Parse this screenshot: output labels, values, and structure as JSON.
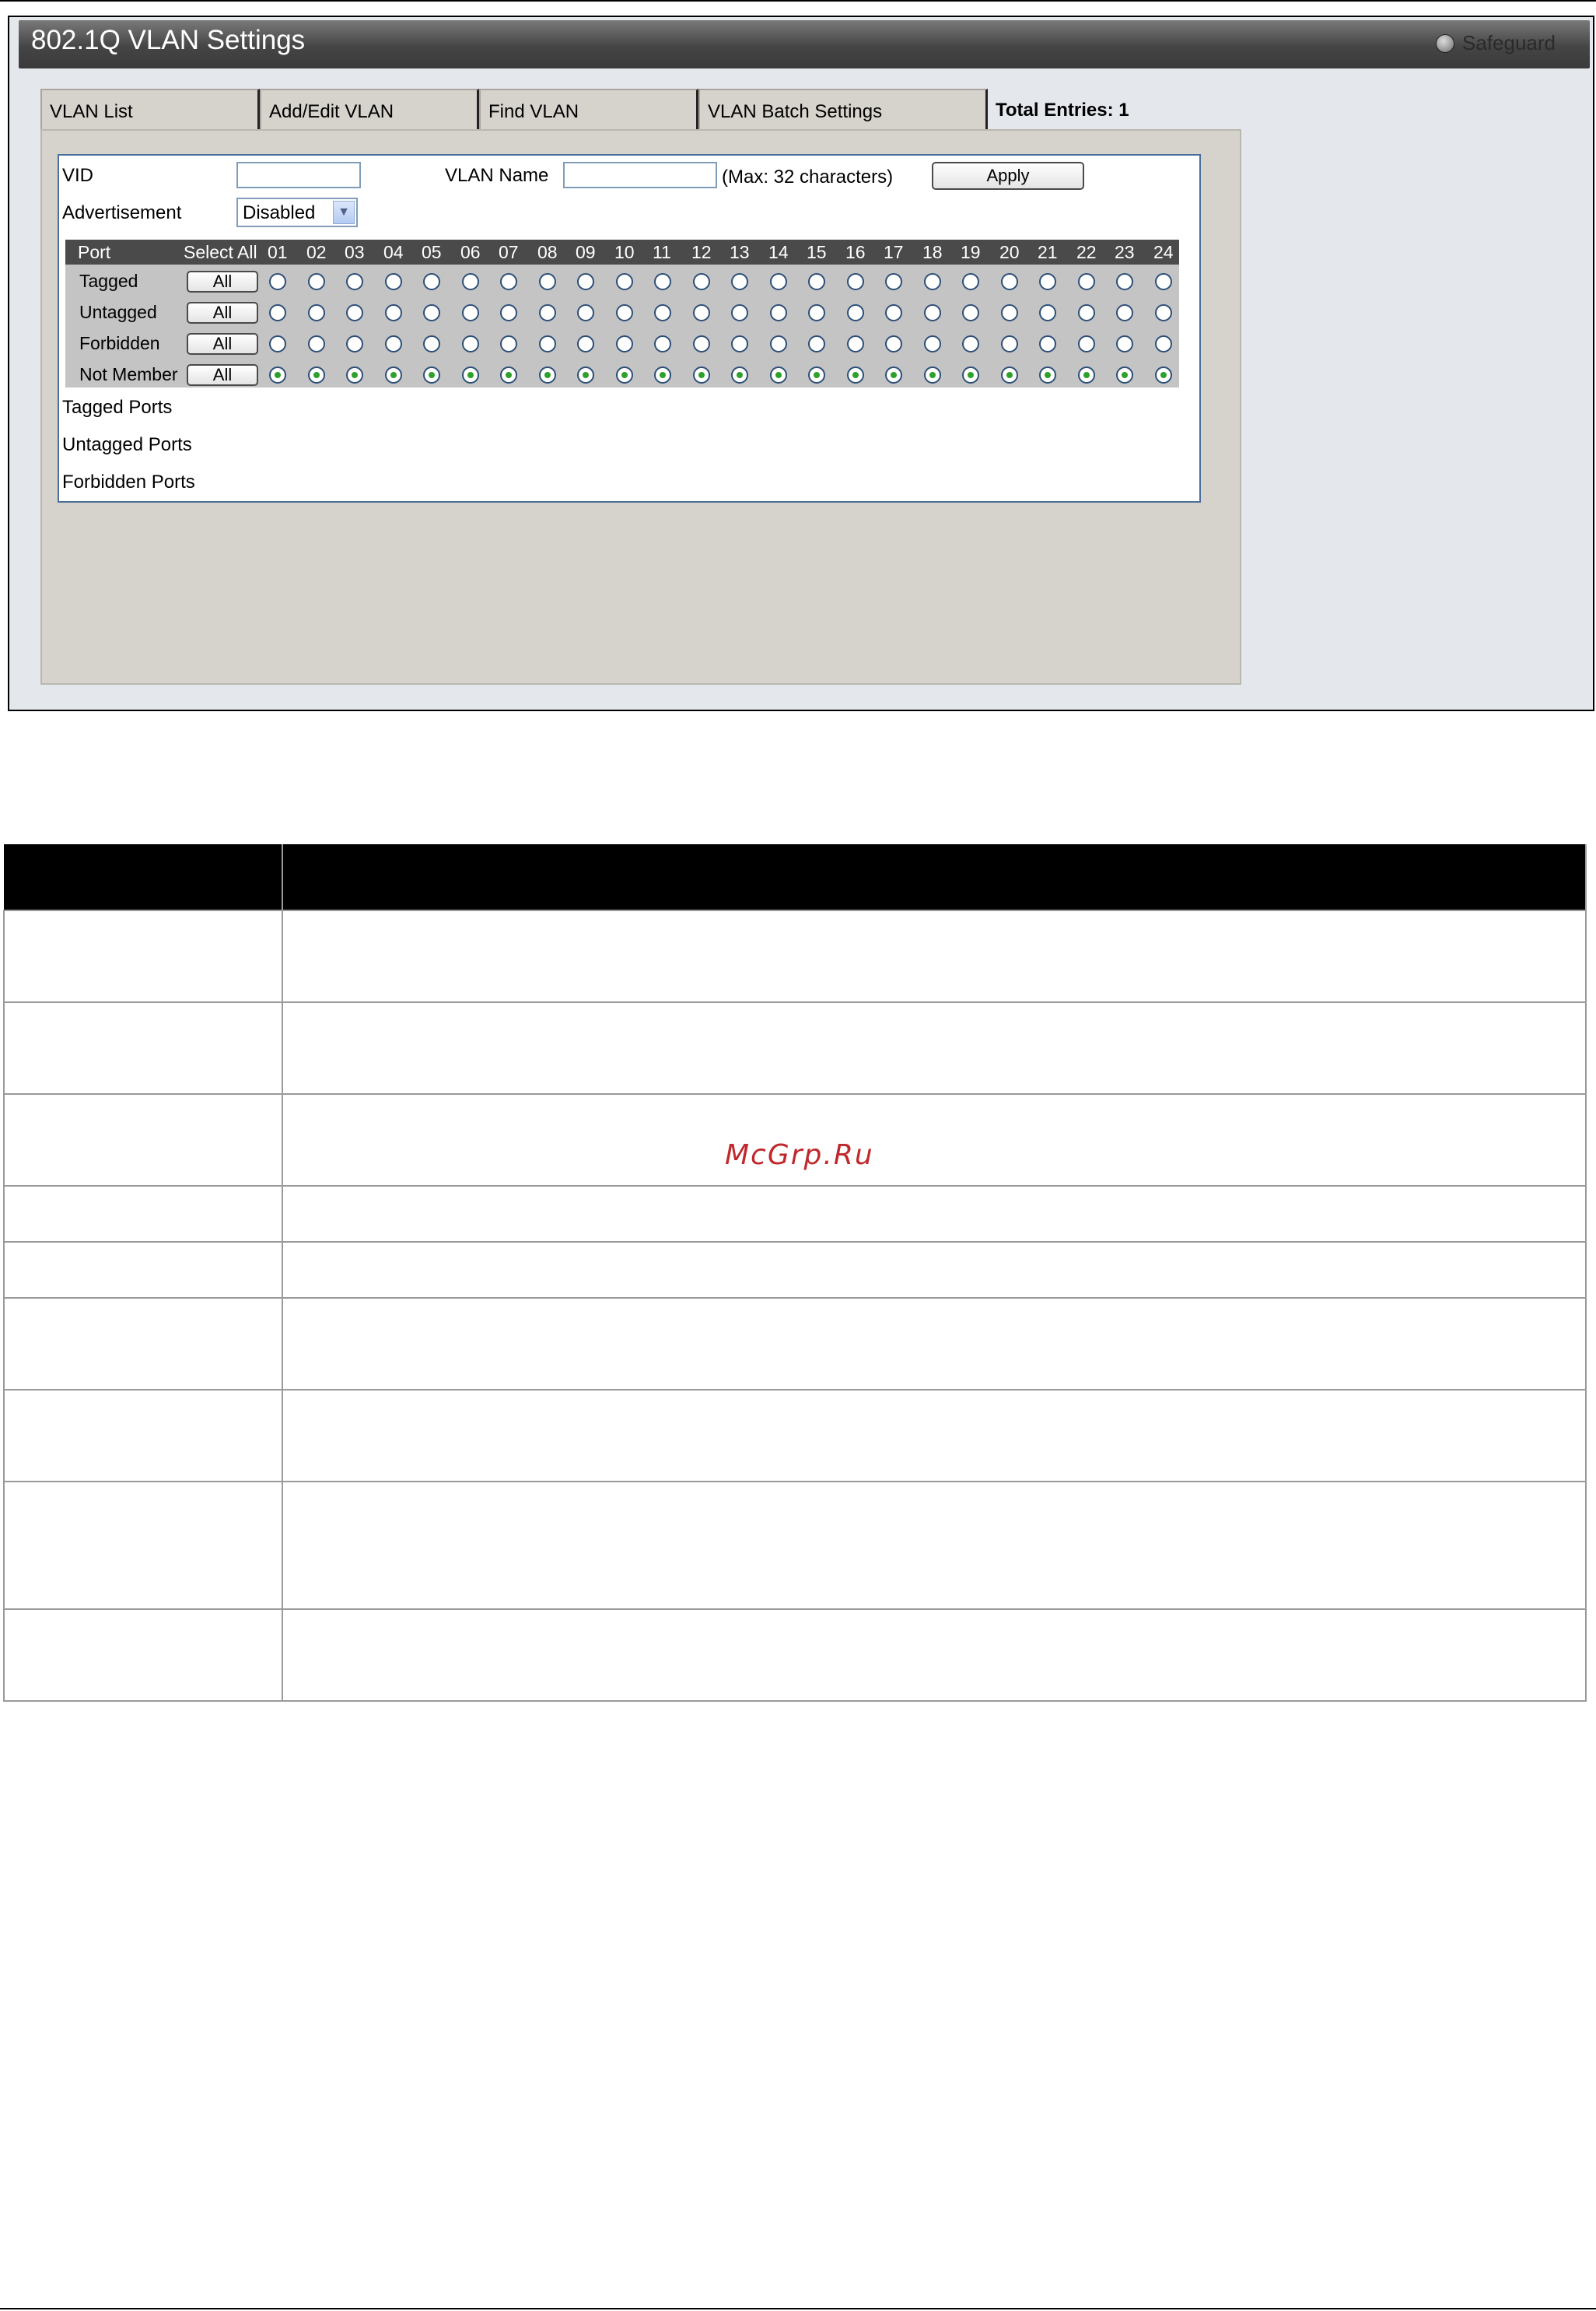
{
  "window": {
    "title": "802.1Q VLAN Settings",
    "safeguard_label": "Safeguard",
    "safeguard_icon": "status-circle-icon"
  },
  "tabs": [
    {
      "label": "VLAN List"
    },
    {
      "label": "Add/Edit VLAN"
    },
    {
      "label": "Find VLAN"
    },
    {
      "label": "VLAN Batch Settings"
    }
  ],
  "total_entries": "Total Entries: 1",
  "form": {
    "vid_label": "VID",
    "vid_value": "",
    "vlan_name_label": "VLAN Name",
    "vlan_name_value": "",
    "vlan_name_hint": "(Max: 32 characters)",
    "apply_label": "Apply",
    "advertisement_label": "Advertisement",
    "advertisement_value": "Disabled",
    "advertisement_arrow": "chevron-down-icon"
  },
  "port_grid": {
    "port_header": "Port",
    "select_all_header": "Select All",
    "ports": [
      "01",
      "02",
      "03",
      "04",
      "05",
      "06",
      "07",
      "08",
      "09",
      "10",
      "11",
      "12",
      "13",
      "14",
      "15",
      "16",
      "17",
      "18",
      "19",
      "20",
      "21",
      "22",
      "23",
      "24"
    ],
    "all_label": "All",
    "rows": [
      {
        "label": "Tagged",
        "selected": false
      },
      {
        "label": "Untagged",
        "selected": false
      },
      {
        "label": "Forbidden",
        "selected": false
      },
      {
        "label": "Not Member",
        "selected": true
      }
    ]
  },
  "port_lists": {
    "tagged_label": "Tagged Ports",
    "untagged_label": "Untagged Ports",
    "forbidden_label": "Forbidden Ports"
  },
  "watermark": "McGrp.Ru"
}
